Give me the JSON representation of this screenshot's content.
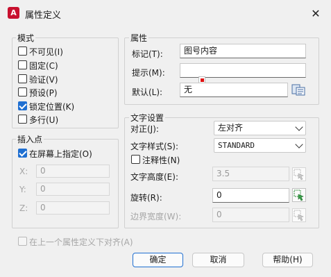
{
  "window": {
    "title": "属性定义",
    "app_icon_letter": "A",
    "close_glyph": "✕"
  },
  "mode": {
    "label": "模式",
    "options": [
      {
        "label": "不可见(I)",
        "checked": false
      },
      {
        "label": "固定(C)",
        "checked": false
      },
      {
        "label": "验证(V)",
        "checked": false
      },
      {
        "label": "预设(P)",
        "checked": false
      },
      {
        "label": "锁定位置(K)",
        "checked": true
      },
      {
        "label": "多行(U)",
        "checked": false
      }
    ]
  },
  "insertion": {
    "label": "插入点",
    "specify_on_screen": {
      "label": "在屏幕上指定(O)",
      "checked": true
    },
    "x": {
      "label": "X:",
      "value": "0"
    },
    "y": {
      "label": "Y:",
      "value": "0"
    },
    "z": {
      "label": "Z:",
      "value": "0"
    }
  },
  "attribute": {
    "label": "属性",
    "tag": {
      "label": "标记(T):",
      "value": "图号内容"
    },
    "prompt": {
      "label": "提示(M):",
      "value": ""
    },
    "default": {
      "label": "默认(L):",
      "value": "无"
    }
  },
  "text_settings": {
    "label": "文字设置",
    "justification": {
      "label": "对正(J):",
      "value": "左对齐"
    },
    "text_style": {
      "label": "文字样式(S):",
      "value": "STANDARD"
    },
    "annotative": {
      "label": "注释性(N)",
      "checked": false
    },
    "text_height": {
      "label": "文字高度(E):",
      "value": "3.5"
    },
    "rotation": {
      "label": "旋转(R):",
      "value": "0"
    },
    "boundary_width": {
      "label": "边界宽度(W):",
      "value": "0"
    }
  },
  "align_below": {
    "label": "在上一个属性定义下对齐(A)",
    "checked": false
  },
  "buttons": {
    "ok": "确定",
    "cancel": "取消",
    "help": "帮助(H)"
  },
  "colors": {
    "accent": "#1f6fd1",
    "app_icon": "#c8102e",
    "pick_active": "#2e8b3a"
  }
}
